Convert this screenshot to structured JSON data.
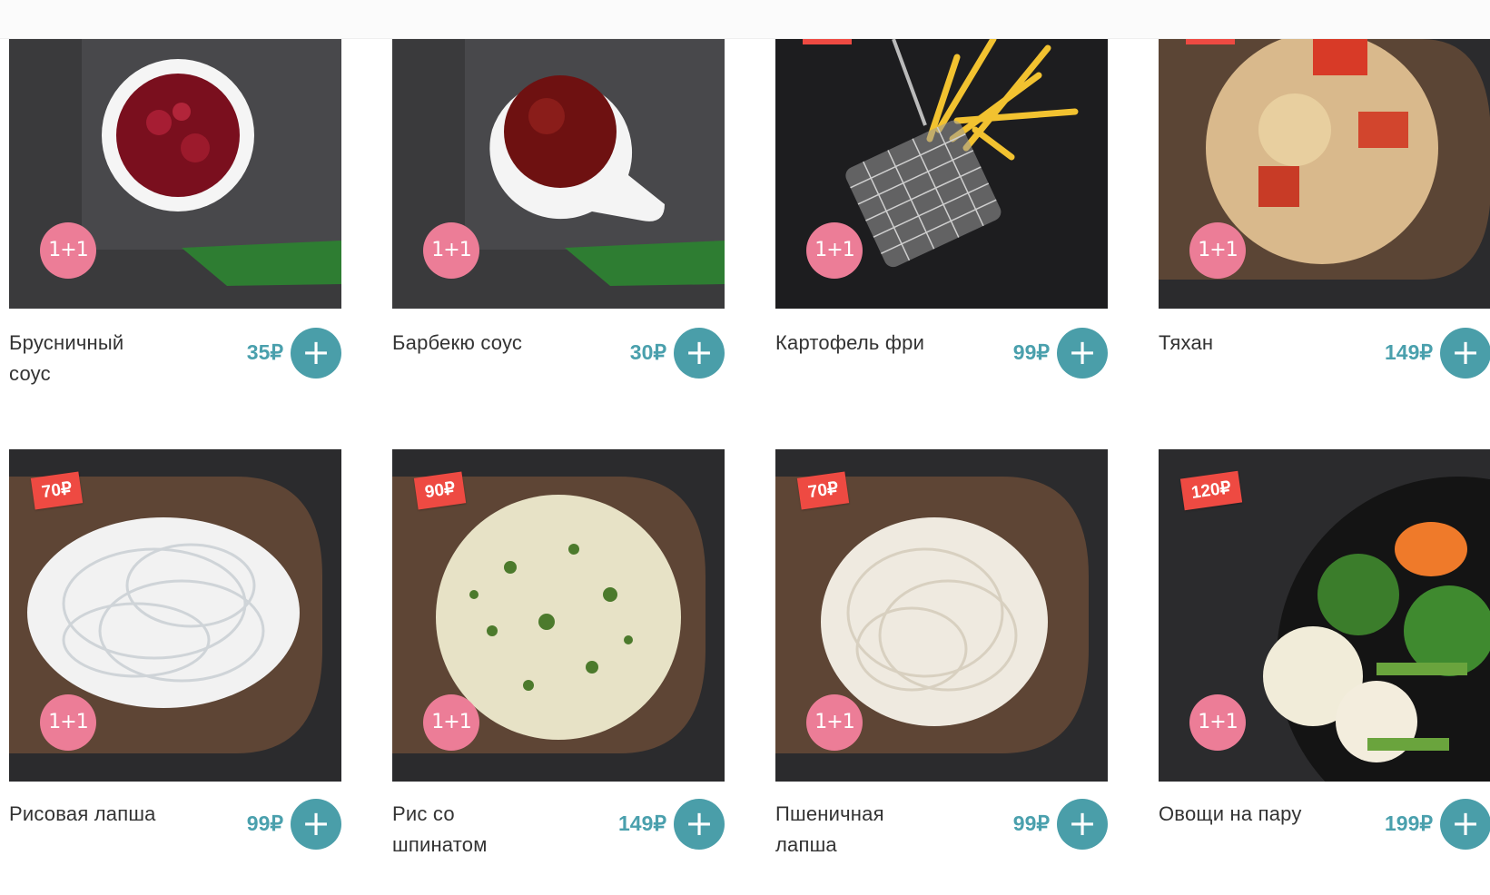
{
  "products": [
    {
      "name": "Брусничный соус",
      "price": "35₽",
      "promo": "1+1"
    },
    {
      "name": "Барбекю соус",
      "price": "30₽",
      "promo": "1+1"
    },
    {
      "name": "Картофель фри",
      "price": "99₽",
      "promo": "1+1"
    },
    {
      "name": "Тяхан",
      "price": "149₽",
      "promo": "1+1"
    },
    {
      "name": "Рисовая лапша",
      "price": "99₽",
      "promo": "1+1",
      "tag": "70₽"
    },
    {
      "name": "Рис со шпинатом",
      "price": "149₽",
      "promo": "1+1",
      "tag": "90₽"
    },
    {
      "name": "Пшеничная лапша",
      "price": "99₽",
      "promo": "1+1",
      "tag": "70₽"
    },
    {
      "name": "Овощи на пару",
      "price": "199₽",
      "promo": "1+1",
      "tag": "120₽"
    }
  ],
  "add_label": "+",
  "colors": {
    "accent": "#4a9ea9",
    "price": "#4aa0ad",
    "promo_badge": "#ec7d97",
    "price_tag": "#ee4a42"
  }
}
